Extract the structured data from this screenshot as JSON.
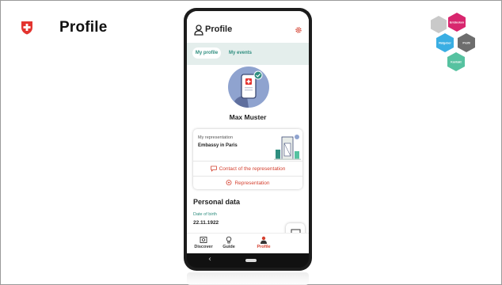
{
  "slide": {
    "title": "Profile"
  },
  "app": {
    "header_title": "Profile",
    "tabs": [
      {
        "label": "My profile",
        "active": true
      },
      {
        "label": "My events",
        "active": false
      }
    ],
    "user_name": "Max Muster",
    "representation": {
      "label": "My representation",
      "value": "Embassy in Paris",
      "actions": [
        {
          "label": "Contact of the representation",
          "icon": "chat-icon"
        },
        {
          "label": "Representation",
          "icon": "location-pin-icon"
        }
      ]
    },
    "personal_data": {
      "title": "Personal data",
      "dob_label": "Date of birth",
      "dob_value": "22.11.1922"
    },
    "bottom_nav": [
      {
        "label": "Discover",
        "icon": "discover-icon"
      },
      {
        "label": "Guide",
        "icon": "lightbulb-icon"
      },
      {
        "label": "Profile",
        "icon": "profile-icon",
        "active": true
      }
    ]
  },
  "hexagons": [
    {
      "label": "",
      "color": "#c9c9c9"
    },
    {
      "label": "Entdecken",
      "color": "#d8266e"
    },
    {
      "label": "Ratgeber",
      "color": "#3aaee3"
    },
    {
      "label": "Profil",
      "color": "#6d6d6d"
    },
    {
      "label": "Kontakt",
      "color": "#56c2a0"
    }
  ],
  "colors": {
    "accent_red": "#d4402f",
    "accent_teal": "#2f8e7f",
    "tab_background": "#e4eeec",
    "swiss_red": "#e3342f"
  }
}
